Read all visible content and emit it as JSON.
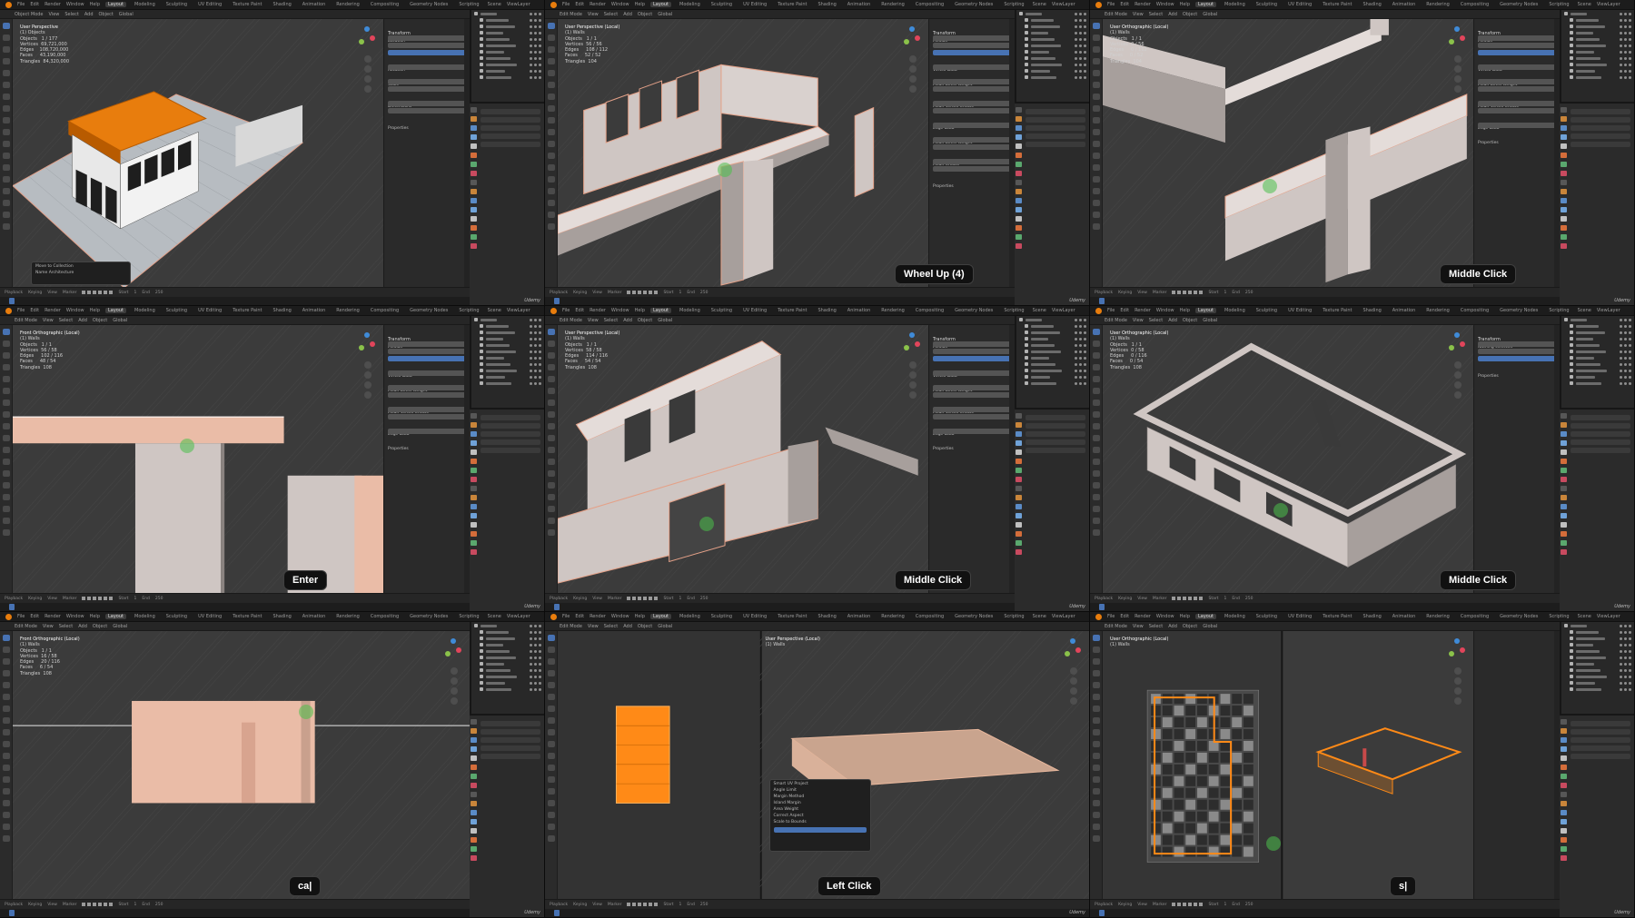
{
  "video": {
    "watermark": "Udemy",
    "accent": "#e87d0d",
    "select_blue": "#4772b3"
  },
  "menu": {
    "items": [
      "File",
      "Edit",
      "Render",
      "Window",
      "Help"
    ],
    "workspaces": [
      "Layout",
      "Modeling",
      "Sculpting",
      "UV Editing",
      "Texture Paint",
      "Shading",
      "Animation",
      "Rendering",
      "Compositing",
      "Geometry Nodes",
      "Scripting"
    ],
    "scene_label": "Scene",
    "view_layer": "ViewLayer"
  },
  "viewport_header": {
    "mode_object": "Object Mode",
    "mode_edit": "Edit Mode",
    "items": [
      "View",
      "Select",
      "Add",
      "Object"
    ],
    "transform": "Global"
  },
  "timeline": {
    "playback": "Playback",
    "keying": "Keying",
    "view": "View",
    "marker": "Marker",
    "start_label": "Start",
    "start_value": "1",
    "end_label": "End",
    "end_value": "250"
  },
  "panels": [
    {
      "id": "p1",
      "view_title": "User Perspective",
      "view_sub": "(1) Objects",
      "stats": [
        "Objects   1 / 177",
        "Vertices  69,721,000",
        "Edges    108,720,000",
        "Faces     43,190,000",
        "Triangles  84,320,000"
      ],
      "sidebar_title": "Transform",
      "sidebar_labels": [
        "Location",
        "Rotation",
        "Scale",
        "Dimensions",
        "Properties"
      ],
      "op_panel_title": "Move to Collection",
      "op_panel_field": "Name",
      "op_panel_value": "Architecture",
      "badge": ""
    },
    {
      "id": "p2",
      "view_title": "User Perspective (Local)",
      "view_sub": "(1) Walls",
      "stats": [
        "Objects   1 / 1",
        "Vertices  56 / 56",
        "Edges     108 / 112",
        "Faces     52 / 52",
        "Triangles  104"
      ],
      "sidebar_title": "Transform",
      "sidebar_labels": [
        "Median",
        "Vertex Data",
        "Mean Bevel Weight",
        "Mean Vertex Crease",
        "Edge Data",
        "Mean Bevel Weight",
        "Mean Crease",
        "Properties"
      ],
      "badge": "Wheel Up (4)"
    },
    {
      "id": "p3",
      "view_title": "User Orthographic (Local)",
      "view_sub": "(1) Walls",
      "stats": [
        "Objects   1 / 1",
        "Vertices  0 / 56",
        "Edges     0 / 112",
        "Faces     0 / 52",
        "Triangles  104"
      ],
      "sidebar_title": "Transform",
      "sidebar_labels": [
        "Median",
        "Vertex Data",
        "Mean Bevel Weight",
        "Mean Vertex Crease",
        "Edge Data",
        "Properties"
      ],
      "badge": "Middle Click"
    },
    {
      "id": "p4",
      "view_title": "Front Orthographic (Local)",
      "view_sub": "(1) Walls",
      "stats": [
        "Objects   1 / 1",
        "Vertices  56 / 58",
        "Edges     102 / 116",
        "Faces     48 / 54",
        "Triangles  108"
      ],
      "sidebar_title": "Transform",
      "sidebar_labels": [
        "Median",
        "Vertex Data",
        "Mean Bevel Weight",
        "Mean Vertex Crease",
        "Edge Data",
        "Properties"
      ],
      "badge": "Enter"
    },
    {
      "id": "p5",
      "view_title": "User Perspective (Local)",
      "view_sub": "(1) Walls",
      "stats": [
        "Objects   1 / 1",
        "Vertices  58 / 58",
        "Edges     114 / 116",
        "Faces     54 / 54",
        "Triangles  108"
      ],
      "sidebar_title": "Transform",
      "sidebar_labels": [
        "Median",
        "Vertex Data",
        "Mean Bevel Weight",
        "Mean Vertex Crease",
        "Edge Data",
        "Properties"
      ],
      "badge": "Middle Click"
    },
    {
      "id": "p6",
      "view_title": "User Orthographic (Local)",
      "view_sub": "(1) Walls",
      "stats": [
        "Objects   1 / 1",
        "Vertices  0 / 58",
        "Edges     0 / 116",
        "Faces     0 / 54",
        "Triangles  108"
      ],
      "sidebar_title": "Transform",
      "sidebar_labels": [
        "Nothing selected",
        "Properties"
      ],
      "badge": "Middle Click"
    },
    {
      "id": "p7",
      "view_title": "Front Orthographic (Local)",
      "view_sub": "(1) Walls",
      "stats": [
        "Objects   1 / 1",
        "Vertices  16 / 58",
        "Edges     20 / 116",
        "Faces     6 / 54",
        "Triangles  108"
      ],
      "sidebar_title": "Transform",
      "sidebar_labels": [
        "Median",
        "Vertex Data",
        "Mean Bevel Weight",
        "Mean Vertex Crease",
        "Edge Data",
        "Properties"
      ],
      "badge": "ca|"
    },
    {
      "id": "p8",
      "view_title": "User Perspective (Local)",
      "view_sub": "(1) Walls",
      "op_panel_title": "Smart UV Project",
      "op_rows": [
        "Angle Limit",
        "Margin Method",
        "Island Margin",
        "Area Weight",
        "Correct Aspect",
        "Scale to Bounds"
      ],
      "badge": "Left Click"
    },
    {
      "id": "p9",
      "view_title": "User Orthographic (Local)",
      "view_sub": "(1) Walls",
      "badge": "s|"
    }
  ]
}
